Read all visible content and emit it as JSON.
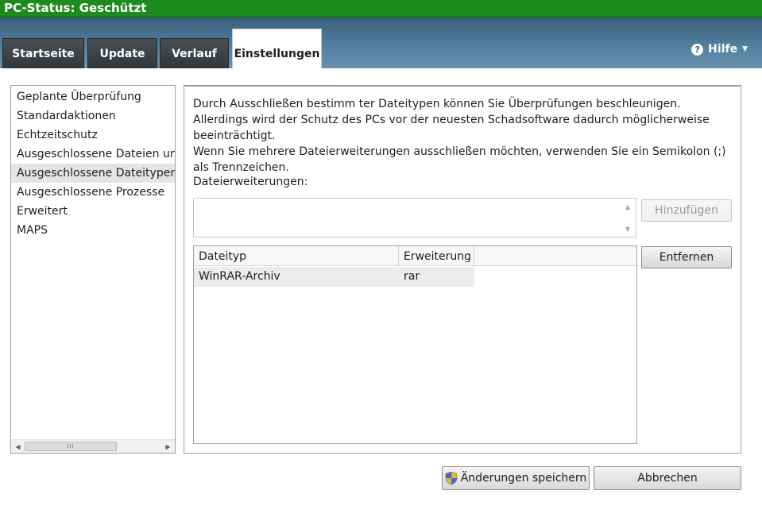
{
  "window": {
    "title": "PC-Status: Geschützt"
  },
  "tabs": [
    {
      "label": "Startseite"
    },
    {
      "label": "Update"
    },
    {
      "label": "Verlauf"
    },
    {
      "label": "Einstellungen",
      "active": true
    }
  ],
  "help": {
    "label": "Hilfe",
    "icon": "question-circle-icon"
  },
  "nav": {
    "items": [
      {
        "label": "Geplante Überprüfung"
      },
      {
        "label": "Standardaktionen"
      },
      {
        "label": "Echtzeitschutz"
      },
      {
        "label": "Ausgeschlossene Dateien und"
      },
      {
        "label": "Ausgeschlossene Dateitypen",
        "selected": true
      },
      {
        "label": "Ausgeschlossene Prozesse"
      },
      {
        "label": "Erweitert"
      },
      {
        "label": "MAPS"
      }
    ],
    "scroll_grip": "III"
  },
  "content": {
    "description": "Durch Ausschließen bestimm ter Dateitypen können Sie Überprüfungen beschleunigen. Allerdings wird der Schutz des PCs vor der neuesten Schadsoftware dadurch möglicherweise beeinträchtigt.",
    "description2": "Wenn Sie mehrere Dateierweiterungen ausschließen möchten, verwenden Sie ein Semikolon (;) als Trennzeichen.",
    "extensions_label": "Dateierweiterungen:",
    "extensions_value": "",
    "add_button": "Hinzufügen",
    "remove_button": "Entfernen",
    "table": {
      "columns": [
        "Dateityp",
        "Erweiterung"
      ],
      "rows": [
        {
          "type": "WinRAR-Archiv",
          "extension": "rar"
        }
      ]
    }
  },
  "footer": {
    "save_button": "Änderungen speichern",
    "cancel_button": "Abbrechen"
  },
  "colors": {
    "titlebar": "#1c8a1c",
    "header": "#55809f",
    "tab_dark": "#3a3e42"
  }
}
